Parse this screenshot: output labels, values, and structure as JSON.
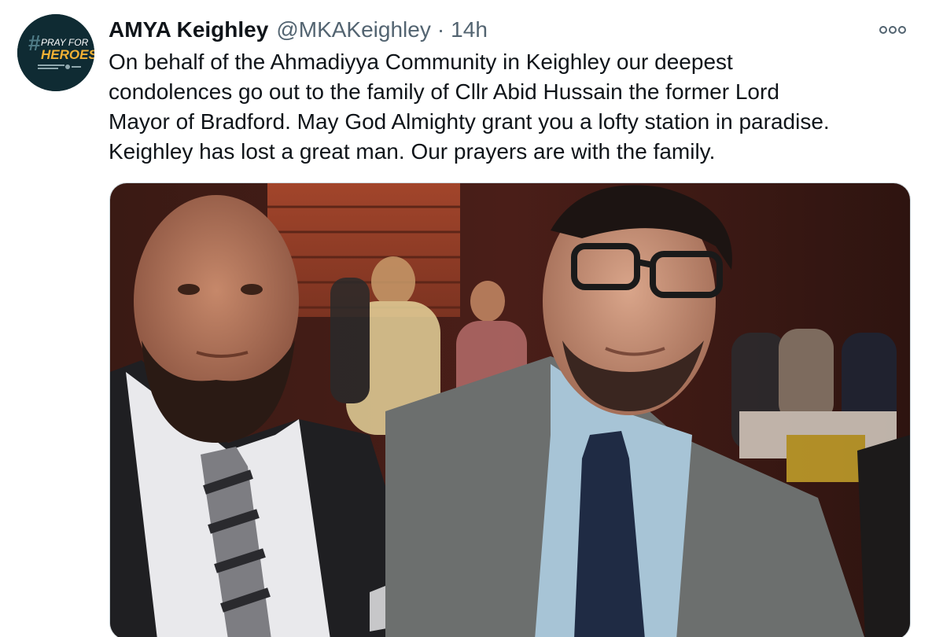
{
  "author": {
    "display_name": "AMYA Keighley",
    "handle": "@MKAKeighley",
    "separator": "·",
    "time": "14h",
    "avatar_icon": "pray-for-heroes-logo",
    "avatar_text_line1": "PRAY FOR",
    "avatar_text_line2": "HEROES"
  },
  "tweet": {
    "text": "On behalf of the Ahmadiyya Community in Keighley our deepest\ncondolences go out to the family of Cllr Abid Hussain the former Lord\nMayor of Bradford. May God Almighty grant you a lofty station in paradise.\nKeighley has lost a great man. Our prayers are with the family."
  },
  "more_menu": {
    "icon": "more-dots-icon"
  },
  "colors": {
    "text_primary": "#0f1419",
    "text_secondary": "#536471",
    "border": "#cfd9de",
    "avatar_bg": "#0f2b33",
    "avatar_accent": "#f2b134"
  }
}
